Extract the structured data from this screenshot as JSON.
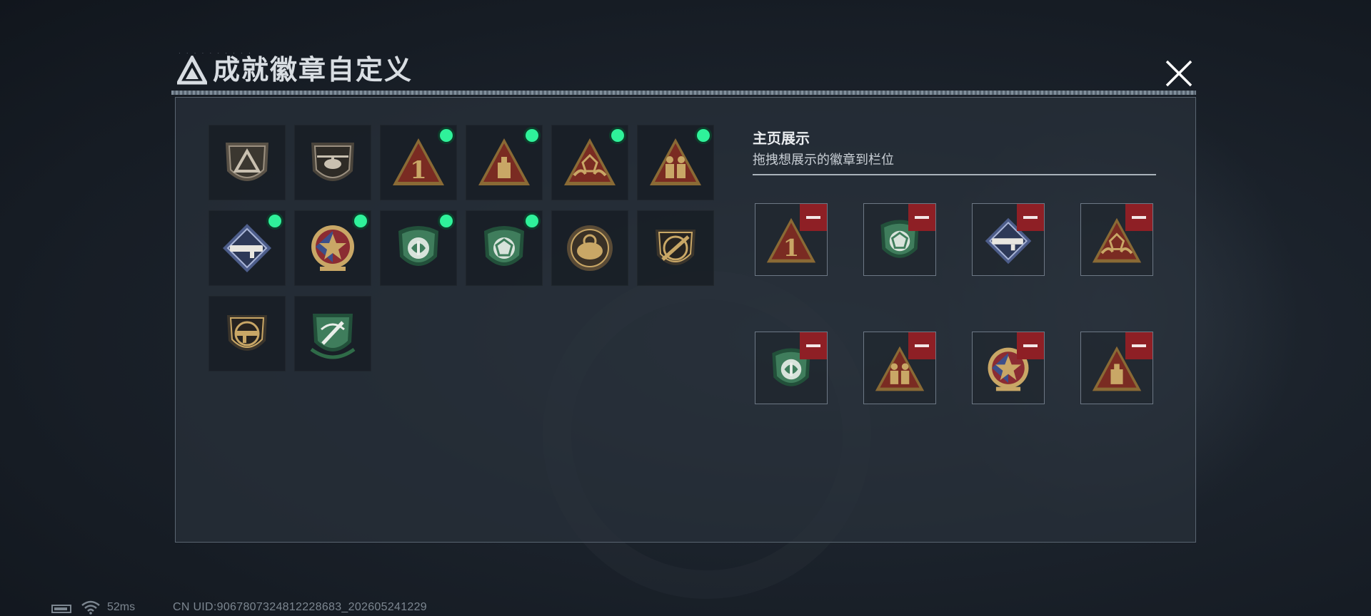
{
  "header": {
    "title": "成就徽章自定义",
    "close_icon": "close-icon"
  },
  "showcase": {
    "title": "主页展示",
    "subtitle": "拖拽想展示的徽章到栏位"
  },
  "badges": [
    {
      "icon": "shield-triangle-badge",
      "equipped": false
    },
    {
      "icon": "helicopter-shield-badge",
      "equipped": false
    },
    {
      "icon": "triangle-number-one-badge",
      "equipped": true
    },
    {
      "icon": "triangle-box-badge",
      "equipped": true
    },
    {
      "icon": "triangle-hands-badge",
      "equipped": true
    },
    {
      "icon": "triangle-soldiers-badge",
      "equipped": true
    },
    {
      "icon": "diamond-launcher-badge",
      "equipped": true
    },
    {
      "icon": "star-medal-badge",
      "equipped": true
    },
    {
      "icon": "green-shield-wing-badge",
      "equipped": true
    },
    {
      "icon": "green-shield-gem-badge",
      "equipped": true
    },
    {
      "icon": "round-helmet-badge",
      "equipped": false
    },
    {
      "icon": "shield-rifle-badge",
      "equipped": false
    },
    {
      "icon": "shield-smg-badge",
      "equipped": false
    },
    {
      "icon": "green-shield-swords-badge",
      "equipped": false
    }
  ],
  "slots": [
    {
      "icon": "triangle-number-one-badge"
    },
    {
      "icon": "green-shield-gem-badge"
    },
    {
      "icon": "diamond-launcher-badge"
    },
    {
      "icon": "triangle-hands-badge"
    },
    {
      "icon": "green-shield-wing-badge"
    },
    {
      "icon": "triangle-soldiers-badge"
    },
    {
      "icon": "star-medal-badge"
    },
    {
      "icon": "triangle-box-badge"
    }
  ],
  "status": {
    "ping": "52ms",
    "uid": "CN UID:9067807324812228683_202605241229"
  },
  "colors": {
    "equipped_dot": "#2ff29a",
    "remove_button": "#8e1f25",
    "gold": "#c9a766",
    "green": "#3f7d5c"
  }
}
